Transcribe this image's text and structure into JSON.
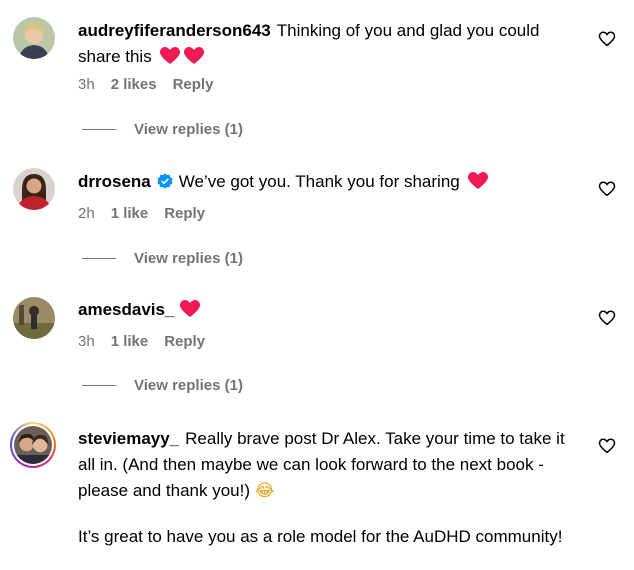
{
  "comments": [
    {
      "username": "audreyfiferanderson643",
      "text": "Thinking of you and glad you could share this",
      "emojis": [
        "heart",
        "heart"
      ],
      "time": "3h",
      "likes": "2 likes",
      "reply": "Reply",
      "view_replies": "View replies (1)"
    },
    {
      "username": "drrosena",
      "verified": true,
      "text": "We’ve got you. Thank you for sharing",
      "emojis": [
        "heart"
      ],
      "time": "2h",
      "likes": "1 like",
      "reply": "Reply",
      "view_replies": "View replies (1)"
    },
    {
      "username": "amesdavis_",
      "text": "",
      "emojis": [
        "heart"
      ],
      "time": "3h",
      "likes": "1 like",
      "reply": "Reply",
      "view_replies": "View replies (1)"
    },
    {
      "username": "steviemayy_",
      "text": "Really brave post Dr Alex. Take your time to take it all in. (And then maybe we can look forward to the next book - please and thank you!)",
      "emoji_after": "😂",
      "text2": "It’s great to have you as a role model for the AuDHD community!"
    }
  ],
  "colors": {
    "heart": "#ed1a55",
    "meta": "#737373",
    "verified": "#0095f6"
  }
}
